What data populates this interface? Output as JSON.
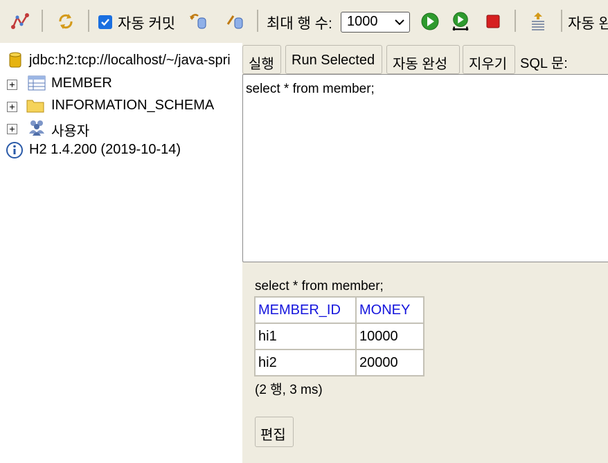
{
  "toolbar": {
    "auto_commit_checked": true,
    "auto_commit_label": "자동 커밋",
    "max_rows_label": "최대 행 수:",
    "max_rows_value": "1000",
    "auto_complete_label": "자동 완",
    "icons": [
      "disconnect-icon",
      "refresh-icon",
      "rollback-icon",
      "commit-icon",
      "run-icon",
      "run-selected-icon",
      "stop-icon",
      "history-icon"
    ]
  },
  "tree": {
    "connection": "jdbc:h2:tcp://localhost/~/java-spri",
    "items": [
      {
        "label": "MEMBER",
        "icon": "table-icon"
      },
      {
        "label": "INFORMATION_SCHEMA",
        "icon": "folder-icon"
      },
      {
        "label": "사용자",
        "icon": "users-icon"
      }
    ],
    "version": "H2 1.4.200 (2019-10-14)"
  },
  "editor_toolbar": {
    "run": "실행",
    "run_selected": "Run Selected",
    "auto_complete": "자동 완성",
    "clear": "지우기",
    "sql_label": "SQL 문:"
  },
  "editor": {
    "text": "select * from member;"
  },
  "result": {
    "statement": "select * from member;",
    "columns": [
      "MEMBER_ID",
      "MONEY"
    ],
    "rows": [
      [
        "hi1",
        "10000"
      ],
      [
        "hi2",
        "20000"
      ]
    ],
    "info": "(2 행, 3 ms)",
    "edit_button": "편집"
  },
  "colors": {
    "toolbar_bg": "#efece0",
    "header_text": "#1515dd",
    "run_green": "#2e9a2e",
    "stop_red": "#d62020"
  }
}
